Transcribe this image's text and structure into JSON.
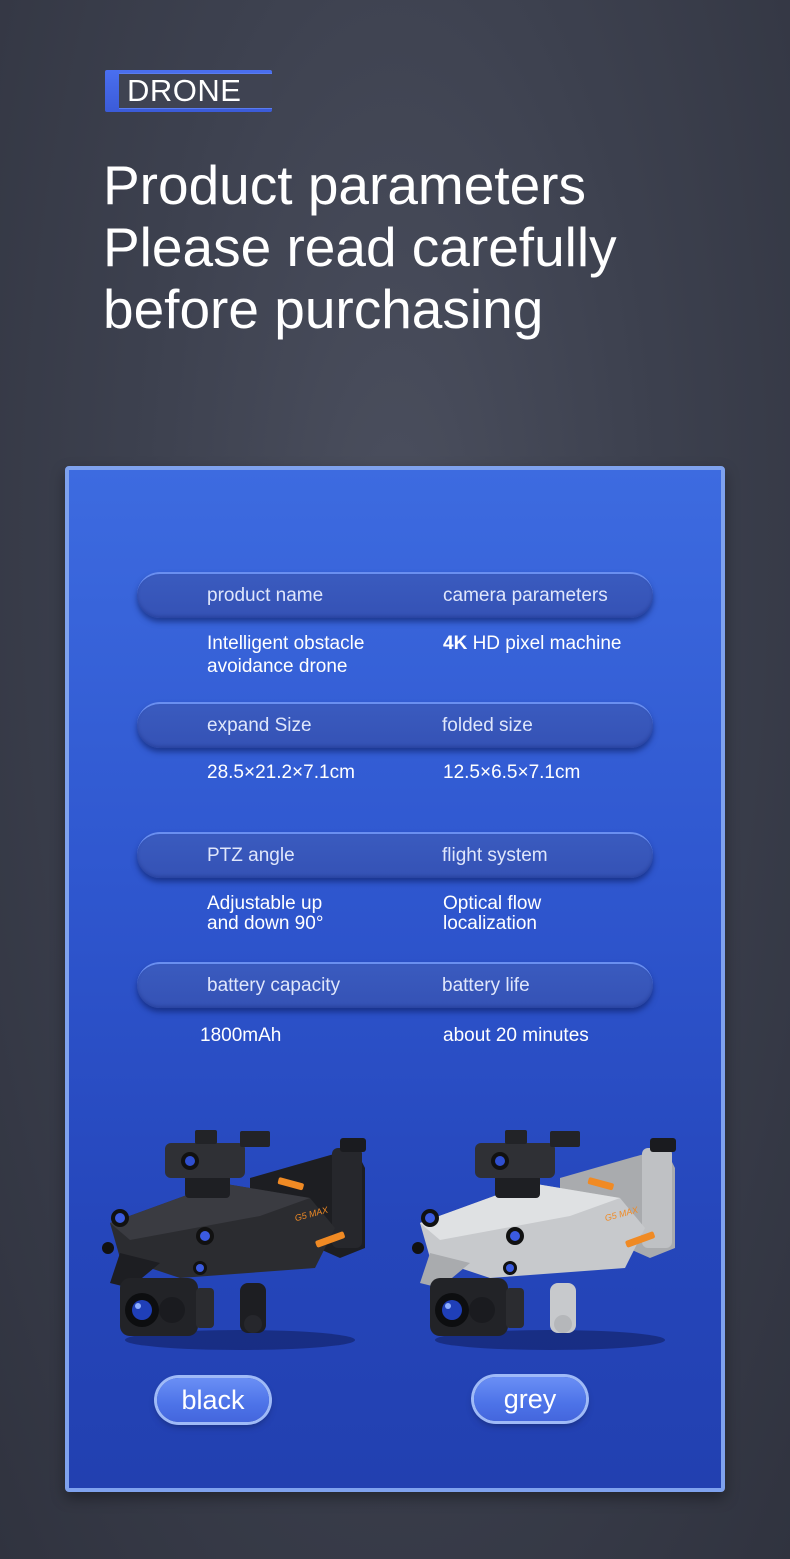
{
  "badge": "DRONE",
  "headline": [
    "Product parameters",
    "Please read carefully",
    "before purchasing"
  ],
  "specs": [
    {
      "left_label": "product name",
      "right_label": "camera parameters",
      "left_value": [
        "Intelligent obstacle",
        "avoidance drone"
      ],
      "right_value_bold": "4K",
      "right_value": " HD pixel machine"
    },
    {
      "left_label": "expand Size",
      "right_label": "folded size",
      "left_value": "28.5×21.2×7.1cm",
      "right_value": "12.5×6.5×7.1cm"
    },
    {
      "left_label": "PTZ angle",
      "right_label": "flight system",
      "left_value": [
        "Adjustable up",
        "and down 90°"
      ],
      "right_value": [
        "Optical flow",
        "localization"
      ]
    },
    {
      "left_label": "battery capacity",
      "right_label": "battery life",
      "left_value": "1800mAh",
      "right_value": "about 20 minutes"
    }
  ],
  "products": [
    {
      "color_label": "black",
      "drone_color": "#2b2c30",
      "brand_text": "G5 MAX"
    },
    {
      "color_label": "grey",
      "drone_color": "#c7c9cc",
      "brand_text": "G5 MAX"
    }
  ],
  "accent_color": "#f08a24"
}
